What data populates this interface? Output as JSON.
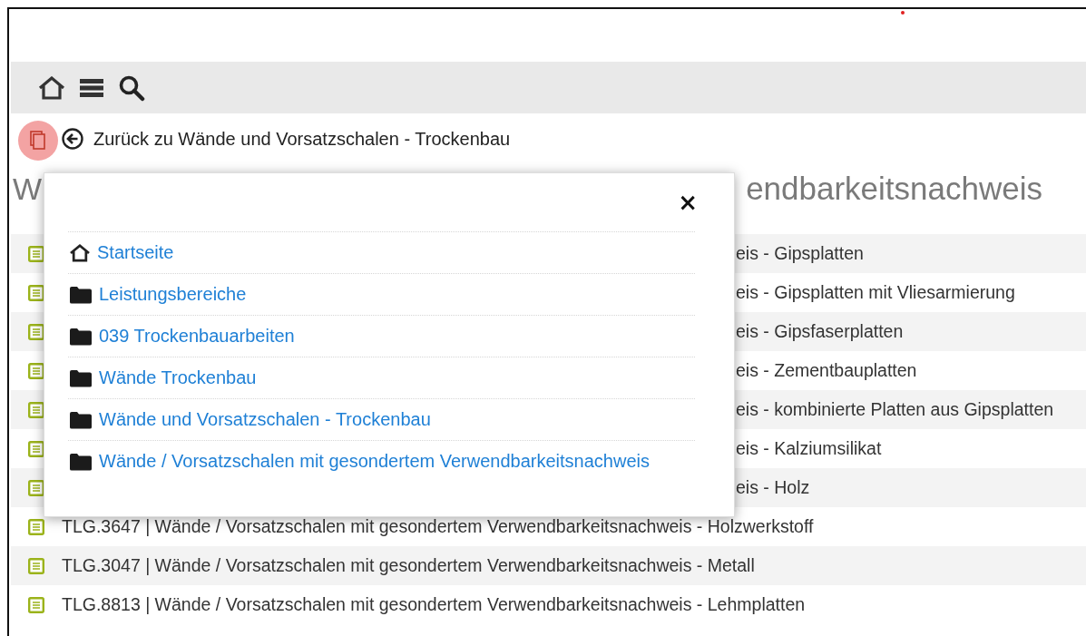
{
  "back_link": "Zurück zu Wände und Vorsatzschalen - Trockenbau",
  "heading_fragments": [
    "W",
    "endbarkeitsnachweis"
  ],
  "rows": [
    {
      "kind": "partial",
      "text": "eis - Gipsplatten"
    },
    {
      "kind": "partial",
      "text": "eis - Gipsplatten mit Vliesarmierung"
    },
    {
      "kind": "partial",
      "text": "eis - Gipsfaserplatten"
    },
    {
      "kind": "partial",
      "text": "eis - Zementbauplatten"
    },
    {
      "kind": "partial",
      "text": "eis - kombinierte Platten aus Gipsplatten"
    },
    {
      "kind": "partial",
      "text": "eis - Kalziumsilikat"
    },
    {
      "kind": "partial",
      "text": "eis - Holz"
    },
    {
      "kind": "full",
      "text": "TLG.3647 | Wände / Vorsatzschalen mit gesondertem Verwendbarkeitsnachweis - Holzwerkstoff"
    },
    {
      "kind": "full",
      "text": "TLG.3047 | Wände / Vorsatzschalen mit gesondertem Verwendbarkeitsnachweis - Metall"
    },
    {
      "kind": "full",
      "text": "TLG.8813 | Wände / Vorsatzschalen mit gesondertem Verwendbarkeitsnachweis - Lehmplatten"
    }
  ],
  "modal": {
    "close": "×",
    "items": [
      {
        "kind": "home",
        "label": "Startseite"
      },
      {
        "kind": "folder",
        "label": "Leistungsbereiche"
      },
      {
        "kind": "folder",
        "label": "039 Trockenbauarbeiten"
      },
      {
        "kind": "folder",
        "label": "Wände Trockenbau"
      },
      {
        "kind": "folder",
        "label": "Wände und Vorsatzschalen - Trockenbau"
      },
      {
        "kind": "folder",
        "label": "Wände / Vorsatzschalen mit gesondertem Verwendbarkeitsnachweis"
      }
    ]
  }
}
